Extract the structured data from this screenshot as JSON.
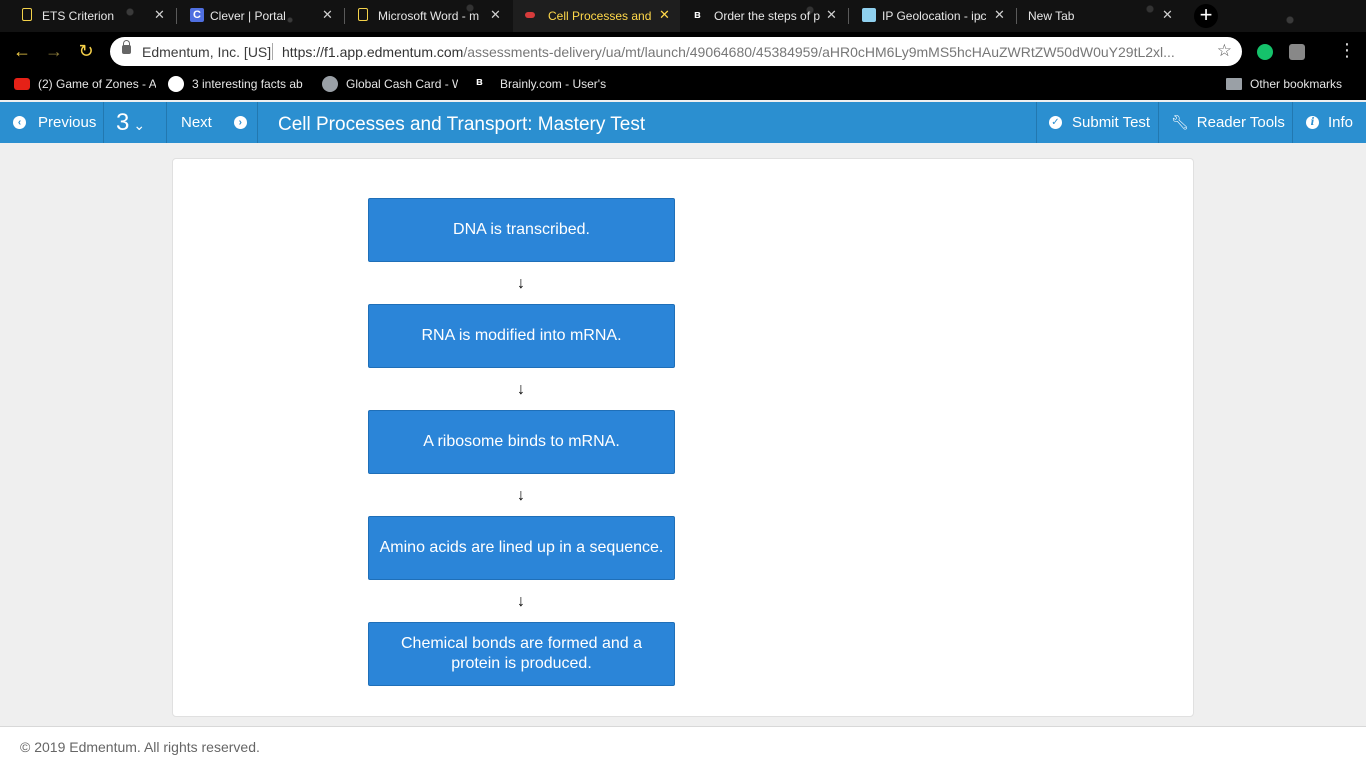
{
  "browser": {
    "tabs": [
      {
        "title": "ETS Criterion",
        "close": "✕"
      },
      {
        "title": "Clever | Portal",
        "close": "✕"
      },
      {
        "title": "Microsoft Word - m",
        "close": "✕"
      },
      {
        "title": "Cell Processes and",
        "close": "✕"
      },
      {
        "title": "Order the steps of p",
        "close": "✕"
      },
      {
        "title": "IP Geolocation - ipc",
        "close": "✕"
      },
      {
        "title": "New Tab",
        "close": "✕"
      }
    ],
    "new_tab": "+",
    "site_identity": "Edmentum, Inc. [US]",
    "url_host": "https://f1.app.edmentum.com",
    "url_path": "/assessments-delivery/ua/mt/launch/49064680/45384959/aHR0cHM6Ly9mMS5hcHAuZWRtZW50dW0uY29tL2xl...",
    "bookmarks": [
      "(2) Game of Zones - A",
      "3 interesting facts ab",
      "Global Cash Card - W",
      "Brainly.com - User's",
      "Other bookmarks"
    ]
  },
  "header": {
    "previous_label": "Previous",
    "question_number": "3",
    "next_label": "Next",
    "title": "Cell Processes and Transport: Mastery Test",
    "submit_label": "Submit Test",
    "reader_tools_label": "Reader Tools",
    "info_label": "Info"
  },
  "sequence": {
    "arrow": "↓",
    "steps": [
      "DNA is transcribed.",
      "RNA is modified into mRNA.",
      "A ribosome binds to mRNA.",
      "Amino acids are lined up in a sequence.",
      "Chemical bonds are formed and a protein is produced."
    ]
  },
  "footer": {
    "copyright": "© 2019 Edmentum. All rights reserved."
  },
  "colors": {
    "header_blue": "#2b8fd0",
    "step_blue": "#2b85d8",
    "active_tab_text": "#ffd84a"
  }
}
